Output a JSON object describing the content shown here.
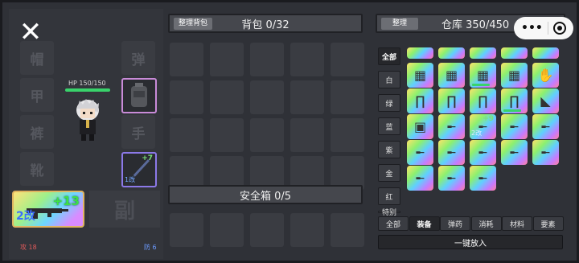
{
  "left": {
    "close_icon": "close-icon",
    "slots": [
      "帽",
      "甲",
      "裤",
      "靴",
      "弹",
      "手",
      "副"
    ],
    "hp_text": "HP 150/150",
    "hp_fraction": 1.0,
    "backpack_icon": "backpack-icon",
    "melee": {
      "plus": "+7",
      "mod": "1改"
    },
    "weapon": {
      "plus": "+13",
      "mod": "2改"
    },
    "attack": "攻 18",
    "defense": "防 6"
  },
  "bag": {
    "sort_label": "整理背包",
    "title": "背包 0/32",
    "safe_title": "安全箱 0/5"
  },
  "warehouse": {
    "sort_label": "整理",
    "title": "仓库 350/450",
    "categories": [
      "全部",
      "白",
      "绿",
      "蓝",
      "紫",
      "金",
      "红",
      "特别"
    ],
    "tabs": [
      "全部",
      "装备",
      "弹药",
      "消耗",
      "材料",
      "要素"
    ],
    "put_all": "一键放入",
    "items": [
      {
        "icon": "vest-icon",
        "rarity": "rainbow",
        "bar": false,
        "plus": "",
        "mod": ""
      },
      {
        "icon": "vest-icon",
        "rarity": "rainbow",
        "bar": false,
        "plus": "",
        "mod": ""
      },
      {
        "icon": "vest-icon",
        "rarity": "rainbow",
        "bar": true,
        "plus": "",
        "mod": ""
      },
      {
        "icon": "vest-icon",
        "rarity": "rainbow",
        "bar": false,
        "plus": "",
        "mod": ""
      },
      {
        "icon": "glove-icon",
        "rarity": "rainbow",
        "bar": false,
        "plus": "",
        "mod": ""
      },
      {
        "icon": "pants-icon",
        "rarity": "rainbow",
        "bar": false,
        "plus": "",
        "mod": ""
      },
      {
        "icon": "pants-icon",
        "rarity": "rainbow",
        "bar": false,
        "plus": "",
        "mod": ""
      },
      {
        "icon": "pants-icon",
        "rarity": "rainbow",
        "bar": false,
        "plus": "",
        "mod": ""
      },
      {
        "icon": "pants-icon",
        "rarity": "rainbow",
        "bar": true,
        "plus": "",
        "mod": ""
      },
      {
        "icon": "boot-icon",
        "rarity": "rainbow",
        "bar": false,
        "plus": "",
        "mod": ""
      },
      {
        "icon": "backpack-icon",
        "rarity": "rainbow",
        "bar": false,
        "plus": "",
        "mod": ""
      },
      {
        "icon": "rifle-icon",
        "rarity": "rainbow",
        "bar": false,
        "plus": "",
        "mod": ""
      },
      {
        "icon": "rifle-icon",
        "rarity": "rainbow",
        "bar": false,
        "plus": "+9",
        "mod": "2改"
      },
      {
        "icon": "rifle-icon",
        "rarity": "rainbow",
        "bar": false,
        "plus": "",
        "mod": ""
      },
      {
        "icon": "rifle-icon",
        "rarity": "rainbow",
        "bar": false,
        "plus": "",
        "mod": ""
      },
      {
        "icon": "rifle-icon",
        "rarity": "rainbow",
        "bar": false,
        "plus": "",
        "mod": ""
      },
      {
        "icon": "rifle-icon",
        "rarity": "rainbow",
        "bar": false,
        "plus": "",
        "mod": ""
      },
      {
        "icon": "rifle-icon",
        "rarity": "rainbow",
        "bar": false,
        "plus": "",
        "mod": ""
      },
      {
        "icon": "rifle-icon",
        "rarity": "rainbow",
        "bar": false,
        "plus": "",
        "mod": ""
      },
      {
        "icon": "rifle-icon",
        "rarity": "rainbow",
        "bar": false,
        "plus": "",
        "mod": ""
      },
      {
        "icon": "rifle-icon",
        "rarity": "rainbow",
        "bar": false,
        "plus": "",
        "mod": ""
      },
      {
        "icon": "rifle-icon",
        "rarity": "rainbow",
        "bar": false,
        "plus": "",
        "mod": ""
      },
      {
        "icon": "rifle-icon",
        "rarity": "rainbow",
        "bar": false,
        "plus": "",
        "mod": ""
      }
    ]
  },
  "capsule": {
    "more_icon": "more-icon",
    "target_icon": "target-icon"
  },
  "colors": {
    "hp": "#39d36b",
    "plus": "#3ee047",
    "mod": "#3b6dff",
    "weapon_border": "#e0b460",
    "melee_border": "#8c79e8"
  }
}
